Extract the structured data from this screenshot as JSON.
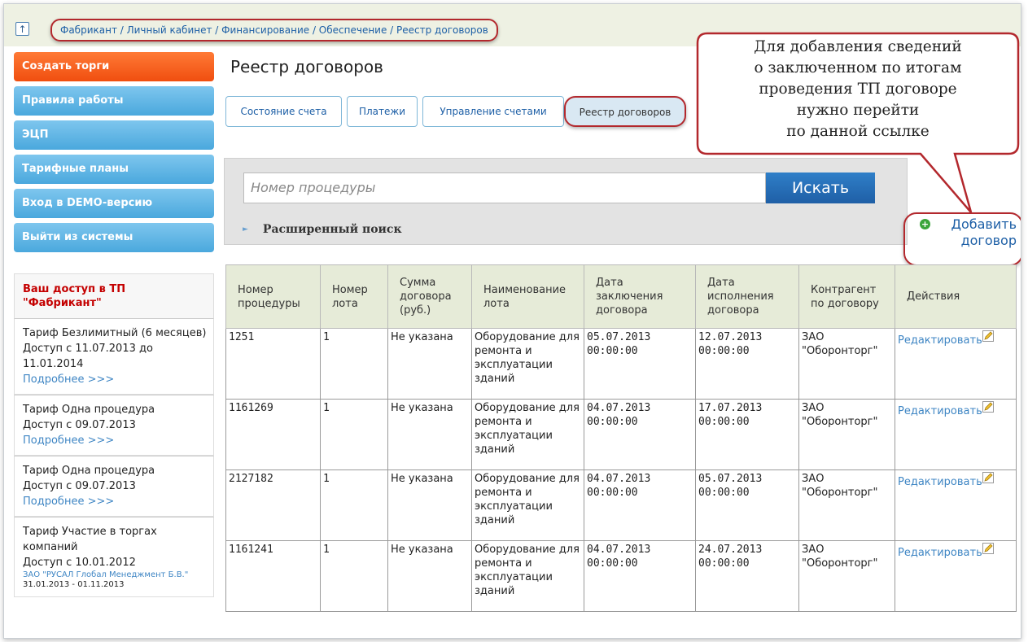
{
  "breadcrumb": "Фабрикант / Личный кабинет / Финансирование / Обеспечение / Реестр договоров",
  "sidebar": {
    "items": [
      {
        "label": "Создать торги"
      },
      {
        "label": "Правила работы"
      },
      {
        "label": "ЭЦП"
      },
      {
        "label": "Тарифные планы"
      },
      {
        "label": "Вход в DEMO-версию"
      },
      {
        "label": "Выйти из системы"
      }
    ]
  },
  "access": {
    "title": "Ваш доступ в ТП \"Фабрикант\"",
    "tariffs": [
      {
        "line1": "Тариф Безлимитный (6 месяцев)",
        "line2": "Доступ с 11.07.2013 до 11.01.2014",
        "more": "Подробнее >>>"
      },
      {
        "line1": "Тариф Одна процедура",
        "line2": "Доступ с 09.07.2013",
        "more": "Подробнее >>>"
      },
      {
        "line1": "Тариф Одна процедура",
        "line2": "Доступ с 09.07.2013",
        "more": "Подробнее >>>"
      },
      {
        "line1": "Тариф Участие в торгах компаний",
        "line2": "Доступ с 10.01.2012",
        "firm": "ЗАО \"РУСАЛ Глобал Менеджмент Б.В.\"",
        "firm_dates": "31.01.2013 - 01.11.2013"
      }
    ]
  },
  "page_title": "Реестр договоров",
  "tabs": [
    {
      "label": "Состояние счета"
    },
    {
      "label": "Платежи"
    },
    {
      "label": "Управление счетами"
    },
    {
      "label": "Реестр договоров",
      "active": true
    }
  ],
  "search": {
    "placeholder": "Номер процедуры",
    "button": "Искать",
    "advanced": "Расширенный поиск"
  },
  "callout": [
    "Для добавления сведений",
    "о заключенном по итогам",
    "проведения ТП договоре",
    "нужно перейти",
    "по данной ссылке"
  ],
  "add_contract": {
    "line1": "Добавить",
    "line2": "договор"
  },
  "table": {
    "headers": [
      "Номер процедуры",
      "Номер лота",
      "Сумма договора (руб.)",
      "Наименование лота",
      "Дата заключения договора",
      "Дата исполнения договора",
      "Контрагент по договору",
      "Действия"
    ],
    "rows": [
      {
        "proc": "1251",
        "lot": "1",
        "sum": "Не указана",
        "name": "Оборудование для ремонта и эксплуатации зданий",
        "date_conc": "05.07.2013 00:00:00",
        "date_exec": "12.07.2013 00:00:00",
        "contractor": "ЗАО \"Оборонторг\"",
        "action": "Редактировать"
      },
      {
        "proc": "1161269",
        "lot": "1",
        "sum": "Не указана",
        "name": "Оборудование для ремонта и эксплуатации зданий",
        "date_conc": "04.07.2013 00:00:00",
        "date_exec": "17.07.2013 00:00:00",
        "contractor": "ЗАО \"Оборонторг\"",
        "action": "Редактировать"
      },
      {
        "proc": "2127182",
        "lot": "1",
        "sum": "Не указана",
        "name": "Оборудование для ремонта и эксплуатации зданий",
        "date_conc": "04.07.2013 00:00:00",
        "date_exec": "05.07.2013 00:00:00",
        "contractor": "ЗАО \"Оборонторг\"",
        "action": "Редактировать"
      },
      {
        "proc": "1161241",
        "lot": "1",
        "sum": "Не указана",
        "name": "Оборудование для ремонта и эксплуатации зданий",
        "date_conc": "04.07.2013 00:00:00",
        "date_exec": "24.07.2013 00:00:00",
        "contractor": "ЗАО \"Оборонторг\"",
        "action": "Редактировать"
      }
    ]
  },
  "colors": {
    "accent": "#3f86c4",
    "highlight_border": "#b3282d",
    "create_button": "#f04e0f",
    "sidebar_button": "#4aa8dd",
    "header_bg": "#e6ebd8"
  }
}
